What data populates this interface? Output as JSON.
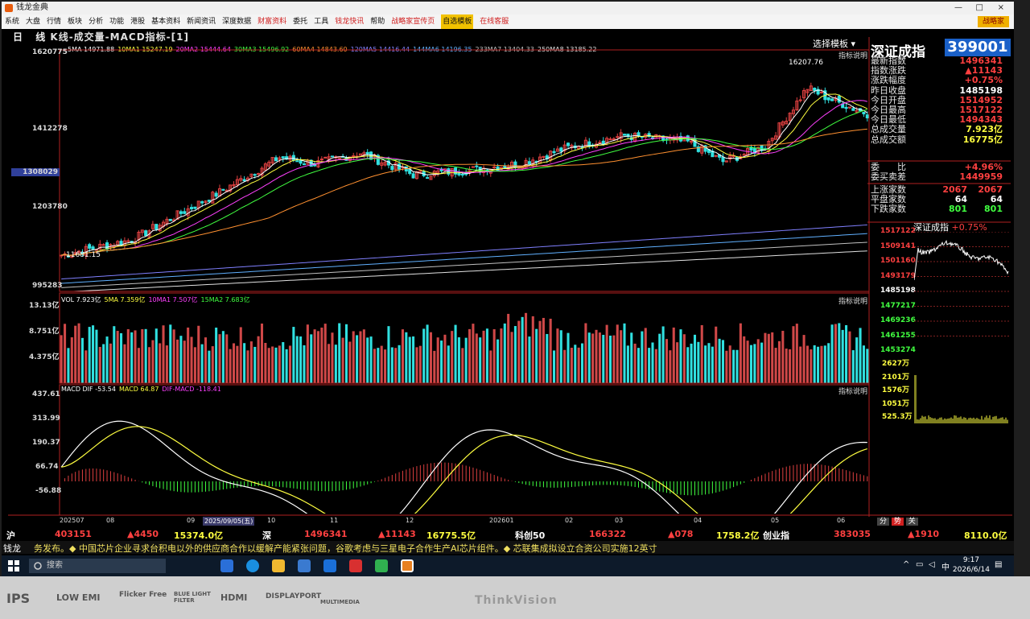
{
  "window": {
    "title": "钱龙金典",
    "controls": [
      "—",
      "□",
      "×"
    ]
  },
  "menu": {
    "items": [
      "系统",
      "大盘",
      "行情",
      "板块",
      "分析",
      "功能",
      "港股",
      "基本资料",
      "新闻资讯",
      "深度数据",
      "财富资料",
      "委托",
      "工具",
      "钱龙快讯",
      "帮助",
      "战略家宣传页",
      "自选模板",
      "在线客服"
    ],
    "red_items": [
      "财富资料",
      "钱龙快讯",
      "战略家宣传页",
      "在线客服"
    ],
    "highlighted": "自选模板",
    "right_button": "战略家"
  },
  "chart_header": {
    "period": "日",
    "period_suffix": "线",
    "title": "K线-成交量-MACD指标-[1]",
    "template_select": "选择模板",
    "indicator_help": "指标说明"
  },
  "ma_legend": [
    {
      "label": "5MA 14971.88",
      "color": "#ffffff"
    },
    {
      "label": "10MA1 15247.19",
      "color": "#ffff40"
    },
    {
      "label": "20MA2 15444.64",
      "color": "#ff40ff"
    },
    {
      "label": "30MA3 15496.92",
      "color": "#40ff40"
    },
    {
      "label": "60MA4 14843.60",
      "color": "#ff9030"
    },
    {
      "label": "120MA5 14416.44",
      "color": "#8080ff"
    },
    {
      "label": "144MA6 14196.35",
      "color": "#60b0ff"
    },
    {
      "label": "233MA7 13404.33",
      "color": "#c0c0c0"
    },
    {
      "label": "250MA8 13185.22",
      "color": "#e0e0e0"
    }
  ],
  "price_axis": [
    "1620775",
    "1412278",
    "1308029",
    "1203780",
    "995283"
  ],
  "annotations": {
    "high": "16207.76",
    "low": "11681.15"
  },
  "vol_legend": [
    {
      "label": "VOL 7.923亿",
      "color": "#ffffff"
    },
    {
      "label": "5MA 7.359亿",
      "color": "#ffff40"
    },
    {
      "label": "10MA1 7.507亿",
      "color": "#ff40ff"
    },
    {
      "label": "15MA2 7.683亿",
      "color": "#40ff40"
    }
  ],
  "vol_axis": [
    "13.13亿",
    "8.751亿",
    "4.375亿"
  ],
  "macd_legend": [
    {
      "label": "MACD DIF -53.54",
      "color": "#ffffff"
    },
    {
      "label": "MACD 64.87",
      "color": "#ffff40"
    },
    {
      "label": "DIF-MACD -118.41",
      "color": "#ff40ff"
    }
  ],
  "macd_axis": [
    "437.61",
    "313.99",
    "190.37",
    "66.74",
    "-56.88"
  ],
  "x_labels": [
    "202507",
    "08",
    "09",
    "2025/09/05(五)",
    "10",
    "11",
    "12",
    "202601",
    "02",
    "03",
    "04",
    "05",
    "06"
  ],
  "right_panel": {
    "index_name": "深证成指",
    "index_code": "399001",
    "rows": [
      {
        "label": "最新指数",
        "value": "1496341",
        "color": "#ff4040"
      },
      {
        "label": "指数涨跌",
        "value": "▲11143",
        "color": "#ff4040"
      },
      {
        "label": "涨跌幅度",
        "value": "+0.75%",
        "color": "#ff4040"
      },
      {
        "label": "昨日收盘",
        "value": "1485198",
        "color": "#ffffff"
      },
      {
        "label": "今日开盘",
        "value": "1514952",
        "color": "#ff4040"
      },
      {
        "label": "今日最高",
        "value": "1517122",
        "color": "#ff4040"
      },
      {
        "label": "今日最低",
        "value": "1494343",
        "color": "#ff4040"
      },
      {
        "label": "总成交量",
        "value": "7.923亿",
        "color": "#ffff40"
      },
      {
        "label": "总成交额",
        "value": "16775亿",
        "color": "#ffff40"
      }
    ],
    "rows2": [
      {
        "label": "委　　比",
        "value": "+4.96%",
        "color": "#ff4040"
      },
      {
        "label": "委买卖差",
        "value": "1449959",
        "color": "#ff4040"
      }
    ],
    "breadth": [
      {
        "label": "上涨家数",
        "v1": "2067",
        "v2": "2067",
        "color": "#ff4040"
      },
      {
        "label": "平盘家数",
        "v1": "64",
        "v2": "64",
        "color": "#ffffff"
      },
      {
        "label": "下跌家数",
        "v1": "801",
        "v2": "801",
        "color": "#40ff40"
      }
    ],
    "mini_title": "深证成指",
    "mini_change": "+0.75%",
    "mini_axis": [
      "1517122",
      "1509141",
      "1501160",
      "1493179",
      "1485198",
      "1477217",
      "1469236",
      "1461255",
      "1453274"
    ],
    "mini_vol_axis": [
      "2627万",
      "2101万",
      "1576万",
      "1051万",
      "525.3万"
    ]
  },
  "bottom_tabs": [
    "分",
    "势",
    "关"
  ],
  "ticker": [
    {
      "text": "沪",
      "color": "#ffffff"
    },
    {
      "text": "403151",
      "color": "#ff4040"
    },
    {
      "text": "▲4450",
      "color": "#ff4040"
    },
    {
      "text": "15374.0亿",
      "color": "#ffff40"
    },
    {
      "text": "深",
      "color": "#ffffff"
    },
    {
      "text": "1496341",
      "color": "#ff4040"
    },
    {
      "text": "▲11143",
      "color": "#ff4040"
    },
    {
      "text": "16775.5亿",
      "color": "#ffff40"
    },
    {
      "text": "科创50",
      "color": "#ffffff"
    },
    {
      "text": "166322",
      "color": "#ff4040"
    },
    {
      "text": "▲078",
      "color": "#ff4040"
    },
    {
      "text": "1758.2亿",
      "color": "#ffff40"
    },
    {
      "text": "创业指",
      "color": "#ffffff"
    },
    {
      "text": "383035",
      "color": "#ff4040"
    },
    {
      "text": "▲1910",
      "color": "#ff4040"
    },
    {
      "text": "8110.0亿",
      "color": "#ffff40"
    }
  ],
  "news": {
    "tag": "钱龙",
    "text": "务发布。◆ 中国芯片企业寻求台积电以外的供应商合作以缓解产能紧张问题，谷歌考虑与三星电子合作生产AI芯片组件。◆ 芯联集成拟设立合资公司实施12英寸"
  },
  "taskbar": {
    "search_placeholder": "搜索",
    "time": "9:17",
    "date": "2026/6/14",
    "ime": "中",
    "clock_right": "09:17"
  },
  "monitor_badges": [
    "IPS",
    "LOW EMI",
    "Flicker Free",
    "BLUE LIGHT FILTER",
    "HDMI",
    "DISPLAYPORT",
    "MULTIMEDIA"
  ],
  "monitor_brand": "ThinkVision",
  "colors": {
    "up": "#e04040",
    "down": "#30e0e0",
    "bg": "#000000"
  }
}
